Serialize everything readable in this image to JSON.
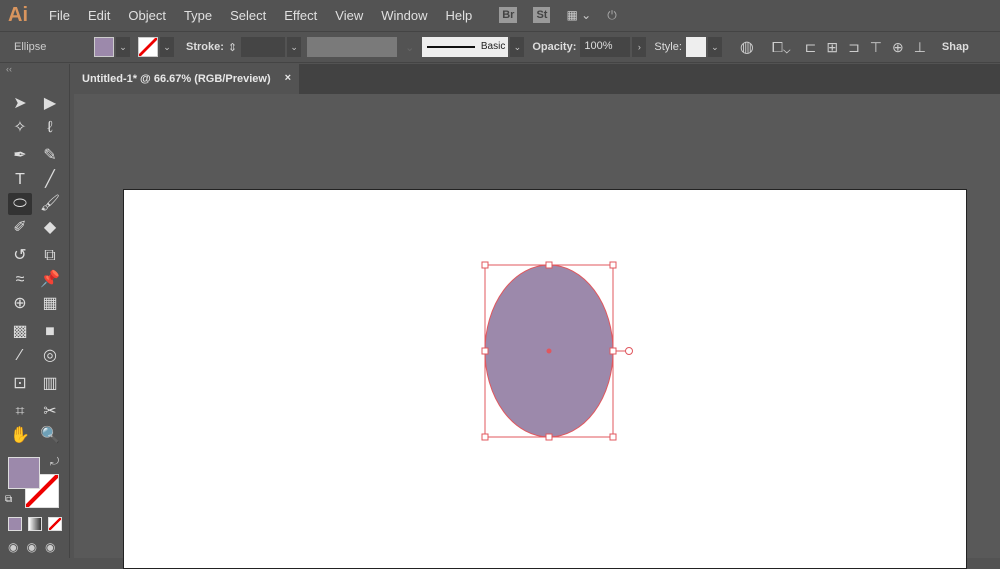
{
  "app": {
    "logo": "Ai",
    "menus": [
      "File",
      "Edit",
      "Object",
      "Type",
      "Select",
      "Effect",
      "View",
      "Window",
      "Help"
    ],
    "bridge": "Br",
    "stock": "St"
  },
  "control": {
    "object_type": "Ellipse",
    "stroke_label": "Stroke:",
    "brush": "Basic",
    "opacity_label": "Opacity:",
    "opacity": "100%",
    "style_label": "Style:",
    "shape_label": "Shap",
    "fill_color": "#9c89ab"
  },
  "document": {
    "tab_title": "Untitled-1* @ 66.67% (RGB/Preview)",
    "close": "×"
  },
  "tools": [
    {
      "name": "selection",
      "g": "➤"
    },
    {
      "name": "direct-selection",
      "g": "▶"
    },
    {
      "name": "magic-wand",
      "g": "✧"
    },
    {
      "name": "lasso",
      "g": "ℓ"
    },
    {
      "name": "pen",
      "g": "✒"
    },
    {
      "name": "curvature",
      "g": "✎"
    },
    {
      "name": "type",
      "g": "T"
    },
    {
      "name": "line",
      "g": "╱"
    },
    {
      "name": "ellipse",
      "g": "⬭",
      "active": true
    },
    {
      "name": "paintbrush",
      "g": "🖌"
    },
    {
      "name": "shaper",
      "g": "✐"
    },
    {
      "name": "eraser",
      "g": "◆"
    },
    {
      "name": "rotate",
      "g": "↺"
    },
    {
      "name": "scale",
      "g": "⧉"
    },
    {
      "name": "warp",
      "g": "≈"
    },
    {
      "name": "puppet-warp",
      "g": "📌"
    },
    {
      "name": "shape-builder",
      "g": "⊕"
    },
    {
      "name": "perspective-grid",
      "g": "▦"
    },
    {
      "name": "mesh",
      "g": "▩"
    },
    {
      "name": "gradient",
      "g": "■"
    },
    {
      "name": "eyedropper",
      "g": "⁄"
    },
    {
      "name": "blend",
      "g": "◎"
    },
    {
      "name": "symbol-sprayer",
      "g": "⊡"
    },
    {
      "name": "column-graph",
      "g": "▥"
    },
    {
      "name": "artboard",
      "g": "⌗"
    },
    {
      "name": "slice",
      "g": "✂"
    },
    {
      "name": "hand",
      "g": "✋"
    },
    {
      "name": "zoom",
      "g": "🔍"
    }
  ]
}
